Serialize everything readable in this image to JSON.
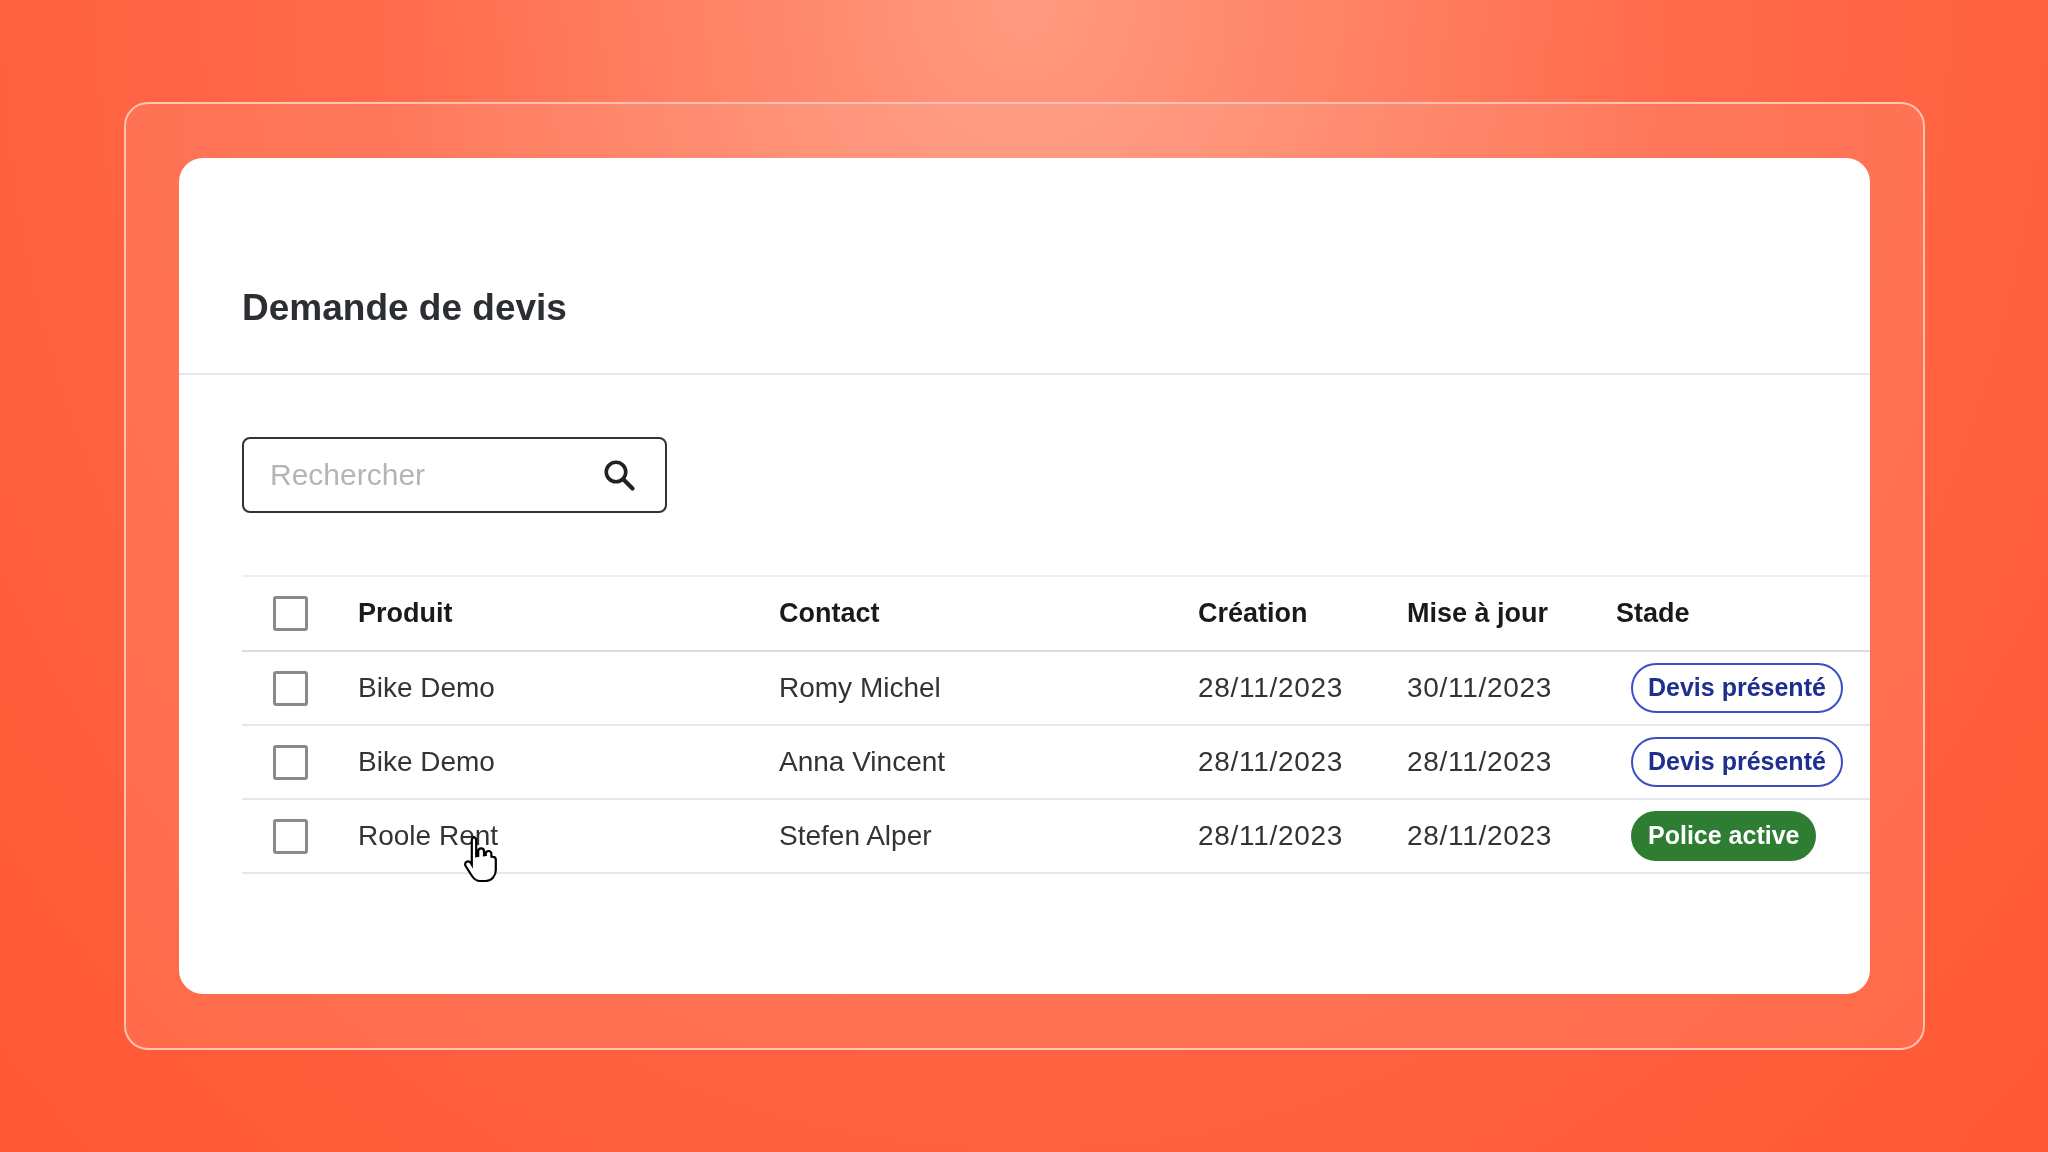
{
  "title": "Demande de devis",
  "search": {
    "placeholder": "Rechercher"
  },
  "table": {
    "header_checkbox": {
      "checked": false
    },
    "columns": [
      "Produit",
      "Contact",
      "Création",
      "Mise à jour",
      "Stade"
    ],
    "rows": [
      {
        "checked": false,
        "product": "Bike Demo",
        "contact": "Romy Michel",
        "created": "28/11/2023",
        "updated": "30/11/2023",
        "stage": {
          "label": "Devis présenté",
          "kind": "outline"
        }
      },
      {
        "checked": false,
        "product": "Bike Demo",
        "contact": "Anna Vincent",
        "created": "28/11/2023",
        "updated": "28/11/2023",
        "stage": {
          "label": "Devis présenté",
          "kind": "outline"
        }
      },
      {
        "checked": false,
        "product": "Roole Rent",
        "contact": "Stefen Alper",
        "created": "28/11/2023",
        "updated": "28/11/2023",
        "stage": {
          "label": "Police active",
          "kind": "filled"
        }
      }
    ]
  }
}
